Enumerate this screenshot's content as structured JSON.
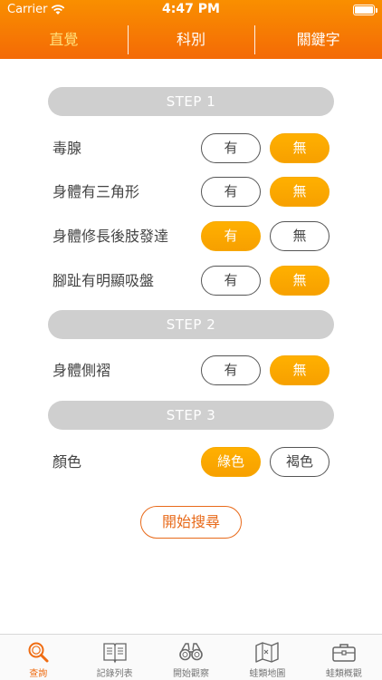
{
  "status": {
    "carrier": "Carrier",
    "time": "4:47 PM"
  },
  "tabs": [
    {
      "label": "直覺",
      "active": true
    },
    {
      "label": "科別",
      "active": false
    },
    {
      "label": "關鍵字",
      "active": false
    }
  ],
  "steps": [
    {
      "title": "STEP 1",
      "questions": [
        {
          "label": "毒腺",
          "options": [
            "有",
            "無"
          ],
          "selected": 1
        },
        {
          "label": "身體有三角形",
          "options": [
            "有",
            "無"
          ],
          "selected": 1
        },
        {
          "label": "身體修長後肢發達",
          "options": [
            "有",
            "無"
          ],
          "selected": 0
        },
        {
          "label": "腳趾有明顯吸盤",
          "options": [
            "有",
            "無"
          ],
          "selected": 1
        }
      ]
    },
    {
      "title": "STEP 2",
      "questions": [
        {
          "label": "身體側褶",
          "options": [
            "有",
            "無"
          ],
          "selected": 1
        }
      ]
    },
    {
      "title": "STEP 3",
      "questions": [
        {
          "label": "顏色",
          "options": [
            "綠色",
            "褐色"
          ],
          "selected": 0
        }
      ]
    }
  ],
  "search_button": "開始搜尋",
  "bottom_nav": [
    {
      "label": "查詢",
      "icon": "magnifier-icon",
      "active": true
    },
    {
      "label": "記錄列表",
      "icon": "book-icon",
      "active": false
    },
    {
      "label": "開始觀察",
      "icon": "binoculars-icon",
      "active": false
    },
    {
      "label": "蛙類地圖",
      "icon": "map-icon",
      "active": false
    },
    {
      "label": "蛙類概觀",
      "icon": "briefcase-icon",
      "active": false
    }
  ],
  "colors": {
    "accent": "#f47a05",
    "selected": "#f9a800",
    "active_tab": "#ffe07a",
    "search_border": "#e86a1a"
  }
}
